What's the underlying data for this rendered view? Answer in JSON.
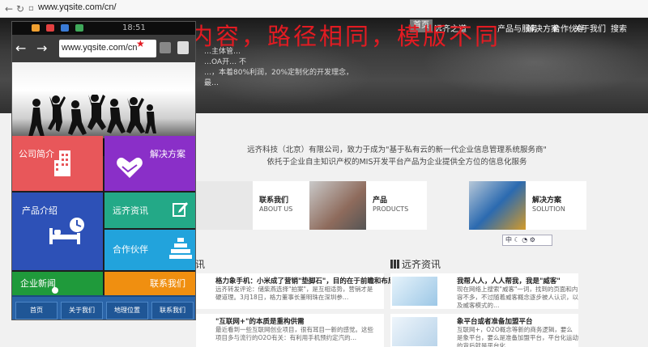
{
  "browser": {
    "url": "www.yqsite.com/cn/"
  },
  "site": {
    "nav": [
      {
        "label": "首页",
        "active": true
      },
      {
        "label": "远齐之道"
      },
      {
        "label": "产品与服务"
      },
      {
        "label": "解决方案"
      },
      {
        "label": "合作伙伴"
      },
      {
        "label": "关于我们"
      },
      {
        "label": "搜索"
      }
    ],
    "banner_lines": [
      "…主体管…",
      "…OA开…   不",
      "…，本着80%利润，20%定制化的开发理念，最…"
    ],
    "overlay_title": "同一内容，路径相同，模版不同",
    "intro_line1": "远齐科技（北京）有限公司，致力于成为\"基于私有云的新一代企业信息管理系统服务商\"",
    "intro_line2": "依托于企业自主知识产权的MIS开发平台产品为企业提供全方位的信息化服务",
    "cards": [
      {
        "title": "联系我们",
        "sub": "ABOUT US"
      },
      {
        "title": "产品",
        "sub": "PRODUCTS"
      },
      {
        "title": "解决方案",
        "sub": "SOLUTION"
      }
    ],
    "widget_text": "中",
    "news_left_tail": "讯",
    "news_left": [
      {
        "title": "格力象手机：小米成了营销\"垫脚石\"，目的在于前瞻和布局",
        "desc": "远齐转发评论：储柴燕选择\"拍案\"，是互相适势，营销才是硬道理。3月18日，格力董事长董明珠在深圳参…"
      },
      {
        "title": "\"互联网+\"的本质是重构供需",
        "desc": "最近看到一些互联网创业项目，很有耳目一新的感觉。这些项目多与流行的O2O有关：有利用手机预约定汽的…"
      }
    ],
    "news_right_title": "远齐资讯",
    "news_right": [
      {
        "title": "我帮人人，人人帮我，我是\"威客\"",
        "desc": "现在网络上搜索\"威客\"一词，找到的页面和内容不多，不过随着威客概念逐步被人认识，以及威客模式的…"
      },
      {
        "title": "象平台或者准备加盟平台",
        "desc": "互联网+，O2O概念等新的商务逻辑，要么是象平台，要么是准备加盟平台，平台化运动的背后就是平台化…"
      }
    ]
  },
  "phone": {
    "clock": "18:51",
    "url": "www.yqsite.com/cn",
    "tiles": [
      {
        "label": "公司简介",
        "color": "#e8575a"
      },
      {
        "label": "解决方案",
        "color": "#8a2fc8"
      },
      {
        "label": "产品介绍",
        "color": "#2d51b7"
      },
      {
        "label": "远齐资讯",
        "color": "#23a987"
      },
      {
        "label": "合作伙伴",
        "color": "#22a3dc"
      },
      {
        "label": "企业新闻",
        "color": "#1f9a3b"
      },
      {
        "label": "联系我们",
        "color": "#f08f10"
      }
    ],
    "footer": [
      "首页",
      "关于我们",
      "地理位置",
      "联系我们"
    ]
  },
  "colors": {
    "accent": "#e21b22",
    "footer_blue": "#2a64a8"
  }
}
